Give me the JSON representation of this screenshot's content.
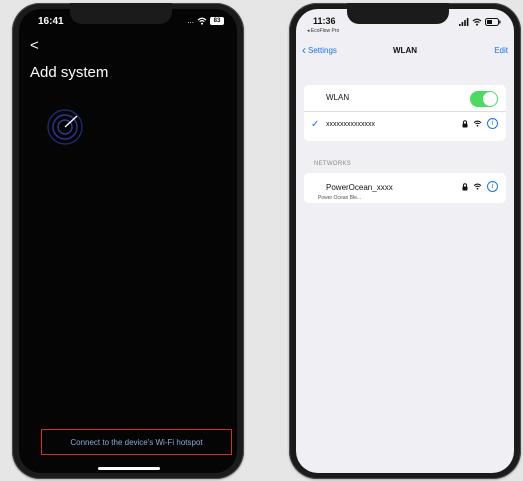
{
  "left_screen": {
    "status_time": "16:41",
    "status_signal": "...",
    "status_wifi": "wifi-icon",
    "status_battery": "83",
    "back_glyph": "<",
    "title": "Add system",
    "radar_icon": "radar-scan-icon",
    "hotspot_link": "Connect to the device's Wi-Fi hotspot",
    "hotspot_color": "#8da9d2",
    "highlight_color": "#d42d2d"
  },
  "right_screen": {
    "status_time": "11:36",
    "status_app": "◂ EcoFlow Pro",
    "nav": {
      "back_label": "Settings",
      "title": "WLAN",
      "edit_label": "Edit"
    },
    "wlan_toggle_label": "WLAN",
    "wlan_enabled": true,
    "connected_network": "xxxxxxxxxxxxxx",
    "networks_header": "NETWORKS",
    "networks": [
      {
        "name": "PowerOcean_xxxx",
        "secured": true
      }
    ],
    "network_subtext": "Power Ocean Ble...",
    "toggle_color": "#4cd964",
    "accent_color": "#1a73e8"
  }
}
